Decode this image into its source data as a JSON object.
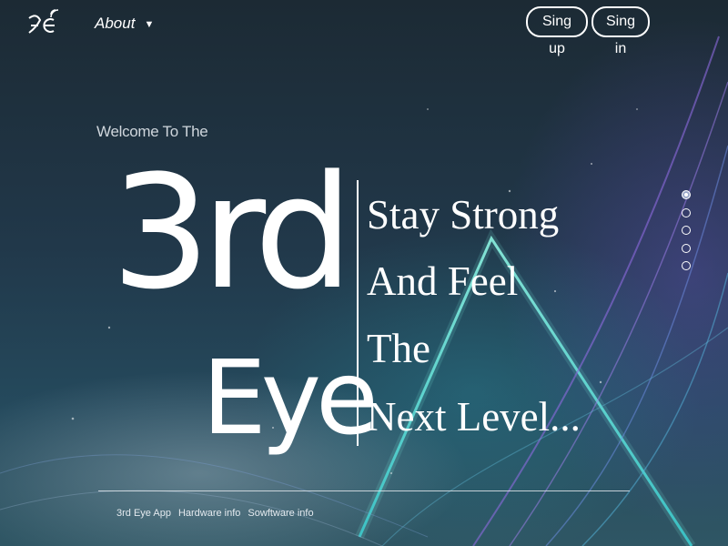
{
  "header": {
    "nav_about": "About",
    "signup_label": "Sing up",
    "signin_label": "Sing in"
  },
  "hero": {
    "welcome": "Welcome To The",
    "brand_line1": "3rd",
    "brand_line2": "Eye",
    "tagline": [
      "Stay Strong",
      "And Feel",
      "The",
      "Next Level..."
    ]
  },
  "carousel": {
    "count": 5,
    "active_index": 0
  },
  "footer": {
    "links": [
      "3rd Eye App",
      "Hardware info",
      "Sowftware info"
    ]
  },
  "colors": {
    "accent_teal": "#4fd8d0",
    "accent_purple": "#8a63d8",
    "bg_dark": "#1c2a34"
  },
  "icons": {
    "logo": "3rd-eye-logo-icon",
    "caret": "caret-down-icon"
  }
}
